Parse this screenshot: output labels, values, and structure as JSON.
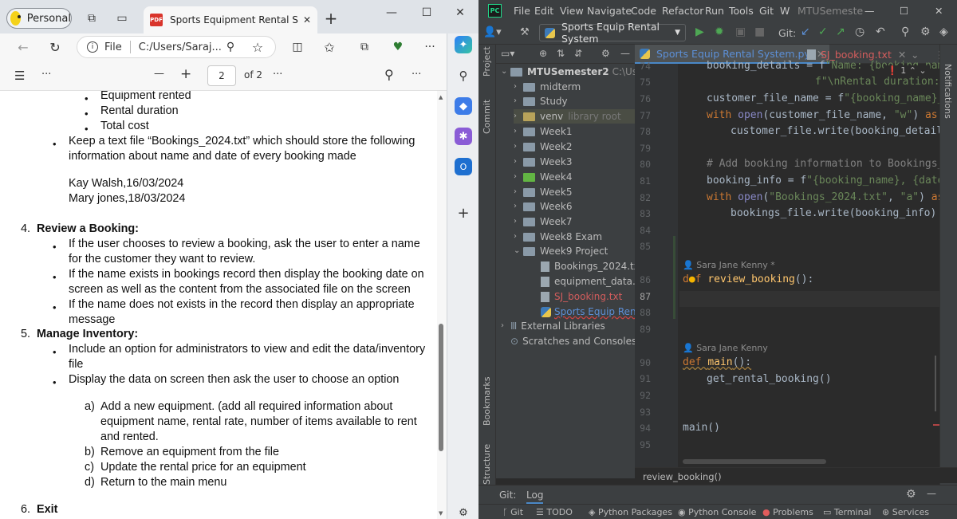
{
  "edge": {
    "profile_label": "Personal",
    "tab_title": "Sports Equipment Rental Syster",
    "address_scheme": "File",
    "address_path": "C:/Users/Saraj...",
    "pdf_toolbar": {
      "minus": "—",
      "plus": "+",
      "page": "2",
      "of_pages": "of 2",
      "more": "···"
    }
  },
  "document": {
    "lines": [
      "Equipment rented",
      "Rental duration",
      "Total cost",
      "Keep a text file “Bookings_2024.txt” which should store the following",
      "information about name and date of every booking made",
      "Kay Walsh,16/03/2024",
      "Mary jones,18/03/2024",
      "Review a Booking:",
      "If the user chooses to review a booking, ask the user to enter a name",
      "for the customer they want to review.",
      "If the name exists in bookings record then display the booking date on",
      "screen as well as the content from the associated file on the screen",
      "If the name does not exists in the record then display an appropriate",
      "message",
      "Manage Inventory:",
      "Include an option for administrators to view and edit the data/inventory",
      "file",
      "Display the data on screen then ask the user to choose an option",
      "Add a new equipment. (add all required information about",
      "equipment name, rental rate, number of items available to rent",
      "and rented.",
      "Remove an equipment from the file",
      "Update the rental price for an equipment",
      "Return to the main menu",
      "Exit"
    ],
    "numbers": [
      "4.",
      "5.",
      "6."
    ],
    "letters": [
      "a)",
      "b)",
      "c)",
      "d)"
    ]
  },
  "ide": {
    "menu": [
      "File",
      "Edit",
      "View",
      "Navigate",
      "Code",
      "Refactor",
      "Run",
      "Tools",
      "Git",
      "W",
      "MTUSemeste"
    ],
    "run_config": "Sports Equip Rental System",
    "git_label": "Git:",
    "side_labels": {
      "project": "Project",
      "commit": "Commit",
      "bookmarks": "Bookmarks",
      "structure": "Structure",
      "notifications": "Notifications"
    },
    "tree": {
      "root": "MTUSemester2",
      "root_path": "C:\\Users\\",
      "folders": [
        "midterm",
        "Study",
        "venv",
        "Week1",
        "Week2",
        "Week3",
        "Week4",
        "Week5",
        "Week6",
        "Week7",
        "Week8 Exam",
        "Week9 Project"
      ],
      "venv_note": "library root",
      "files": [
        "Bookings_2024.txt",
        "equipment_data.txt",
        "SJ_booking.txt",
        "Sports Equip Rental"
      ],
      "external": "External Libraries",
      "scratches": "Scratches and Consoles"
    },
    "tabs": [
      {
        "label": "Sports Equip Rental System.py"
      },
      {
        "label": "SJ_booking.txt"
      }
    ],
    "warning_count": "1",
    "line_numbers": [
      "74",
      "75",
      "76",
      "77",
      "78",
      "79",
      "80",
      "81",
      "82",
      "83",
      "84",
      "85",
      "86",
      "87",
      "88",
      "89",
      "90",
      "91",
      "92",
      "93",
      "94",
      "95"
    ],
    "author_hint": "Sara Jane Kenny *",
    "author_hint2": "Sara Jane Kenny",
    "breadcrumb": "review_booking()",
    "gitbar": {
      "git": "Git:",
      "log": "Log"
    },
    "bottom": [
      "Git",
      "TODO",
      "Python Packages",
      "Python Console",
      "Problems",
      "Terminal",
      "Services"
    ]
  }
}
